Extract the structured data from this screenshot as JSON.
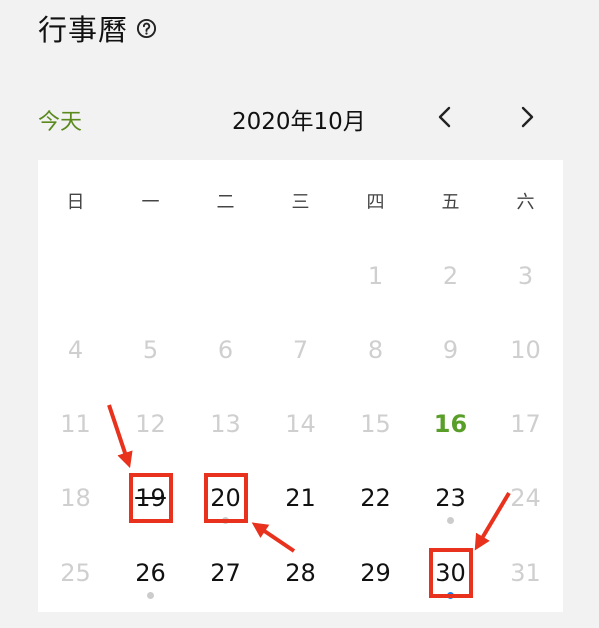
{
  "header": {
    "title": "行事曆"
  },
  "toolbar": {
    "today_label": "今天",
    "month_label": "2020年10月"
  },
  "calendar": {
    "weekdays": [
      "日",
      "一",
      "二",
      "三",
      "四",
      "五",
      "六"
    ],
    "weeks": [
      [
        {
          "label": ""
        },
        {
          "label": ""
        },
        {
          "label": ""
        },
        {
          "label": ""
        },
        {
          "label": "1",
          "state": "muted"
        },
        {
          "label": "2",
          "state": "muted"
        },
        {
          "label": "3",
          "state": "muted"
        }
      ],
      [
        {
          "label": "4",
          "state": "muted"
        },
        {
          "label": "5",
          "state": "muted"
        },
        {
          "label": "6",
          "state": "muted"
        },
        {
          "label": "7",
          "state": "muted"
        },
        {
          "label": "8",
          "state": "muted"
        },
        {
          "label": "9",
          "state": "muted"
        },
        {
          "label": "10",
          "state": "muted"
        }
      ],
      [
        {
          "label": "11",
          "state": "muted"
        },
        {
          "label": "12",
          "state": "muted"
        },
        {
          "label": "13",
          "state": "muted"
        },
        {
          "label": "14",
          "state": "muted"
        },
        {
          "label": "15",
          "state": "muted"
        },
        {
          "label": "16",
          "state": "today"
        },
        {
          "label": "17",
          "state": "muted"
        }
      ],
      [
        {
          "label": "18",
          "state": "muted"
        },
        {
          "label": "19",
          "state": "active",
          "strikethrough": true,
          "highlighted": true
        },
        {
          "label": "20",
          "state": "active",
          "dot": "grey",
          "highlighted": true
        },
        {
          "label": "21",
          "state": "active"
        },
        {
          "label": "22",
          "state": "active"
        },
        {
          "label": "23",
          "state": "active",
          "dot": "grey"
        },
        {
          "label": "24",
          "state": "muted"
        }
      ],
      [
        {
          "label": "25",
          "state": "muted"
        },
        {
          "label": "26",
          "state": "active",
          "dot": "grey"
        },
        {
          "label": "27",
          "state": "active"
        },
        {
          "label": "28",
          "state": "active"
        },
        {
          "label": "29",
          "state": "active"
        },
        {
          "label": "30",
          "state": "active",
          "dot": "blue",
          "highlighted": true
        },
        {
          "label": "31",
          "state": "muted"
        }
      ]
    ]
  },
  "colors": {
    "background": "#f2f2f2",
    "calendar_bg": "#ffffff",
    "today_button": "#5a8a1e",
    "today_date": "#5a9e2a",
    "muted_date": "#cfcfcf",
    "dot_grey": "#cccccc",
    "dot_blue": "#1a7fe8",
    "annotation_red": "#e8321e"
  },
  "icons": {
    "help": "help-icon",
    "prev": "chevron-left-icon",
    "next": "chevron-right-icon"
  }
}
